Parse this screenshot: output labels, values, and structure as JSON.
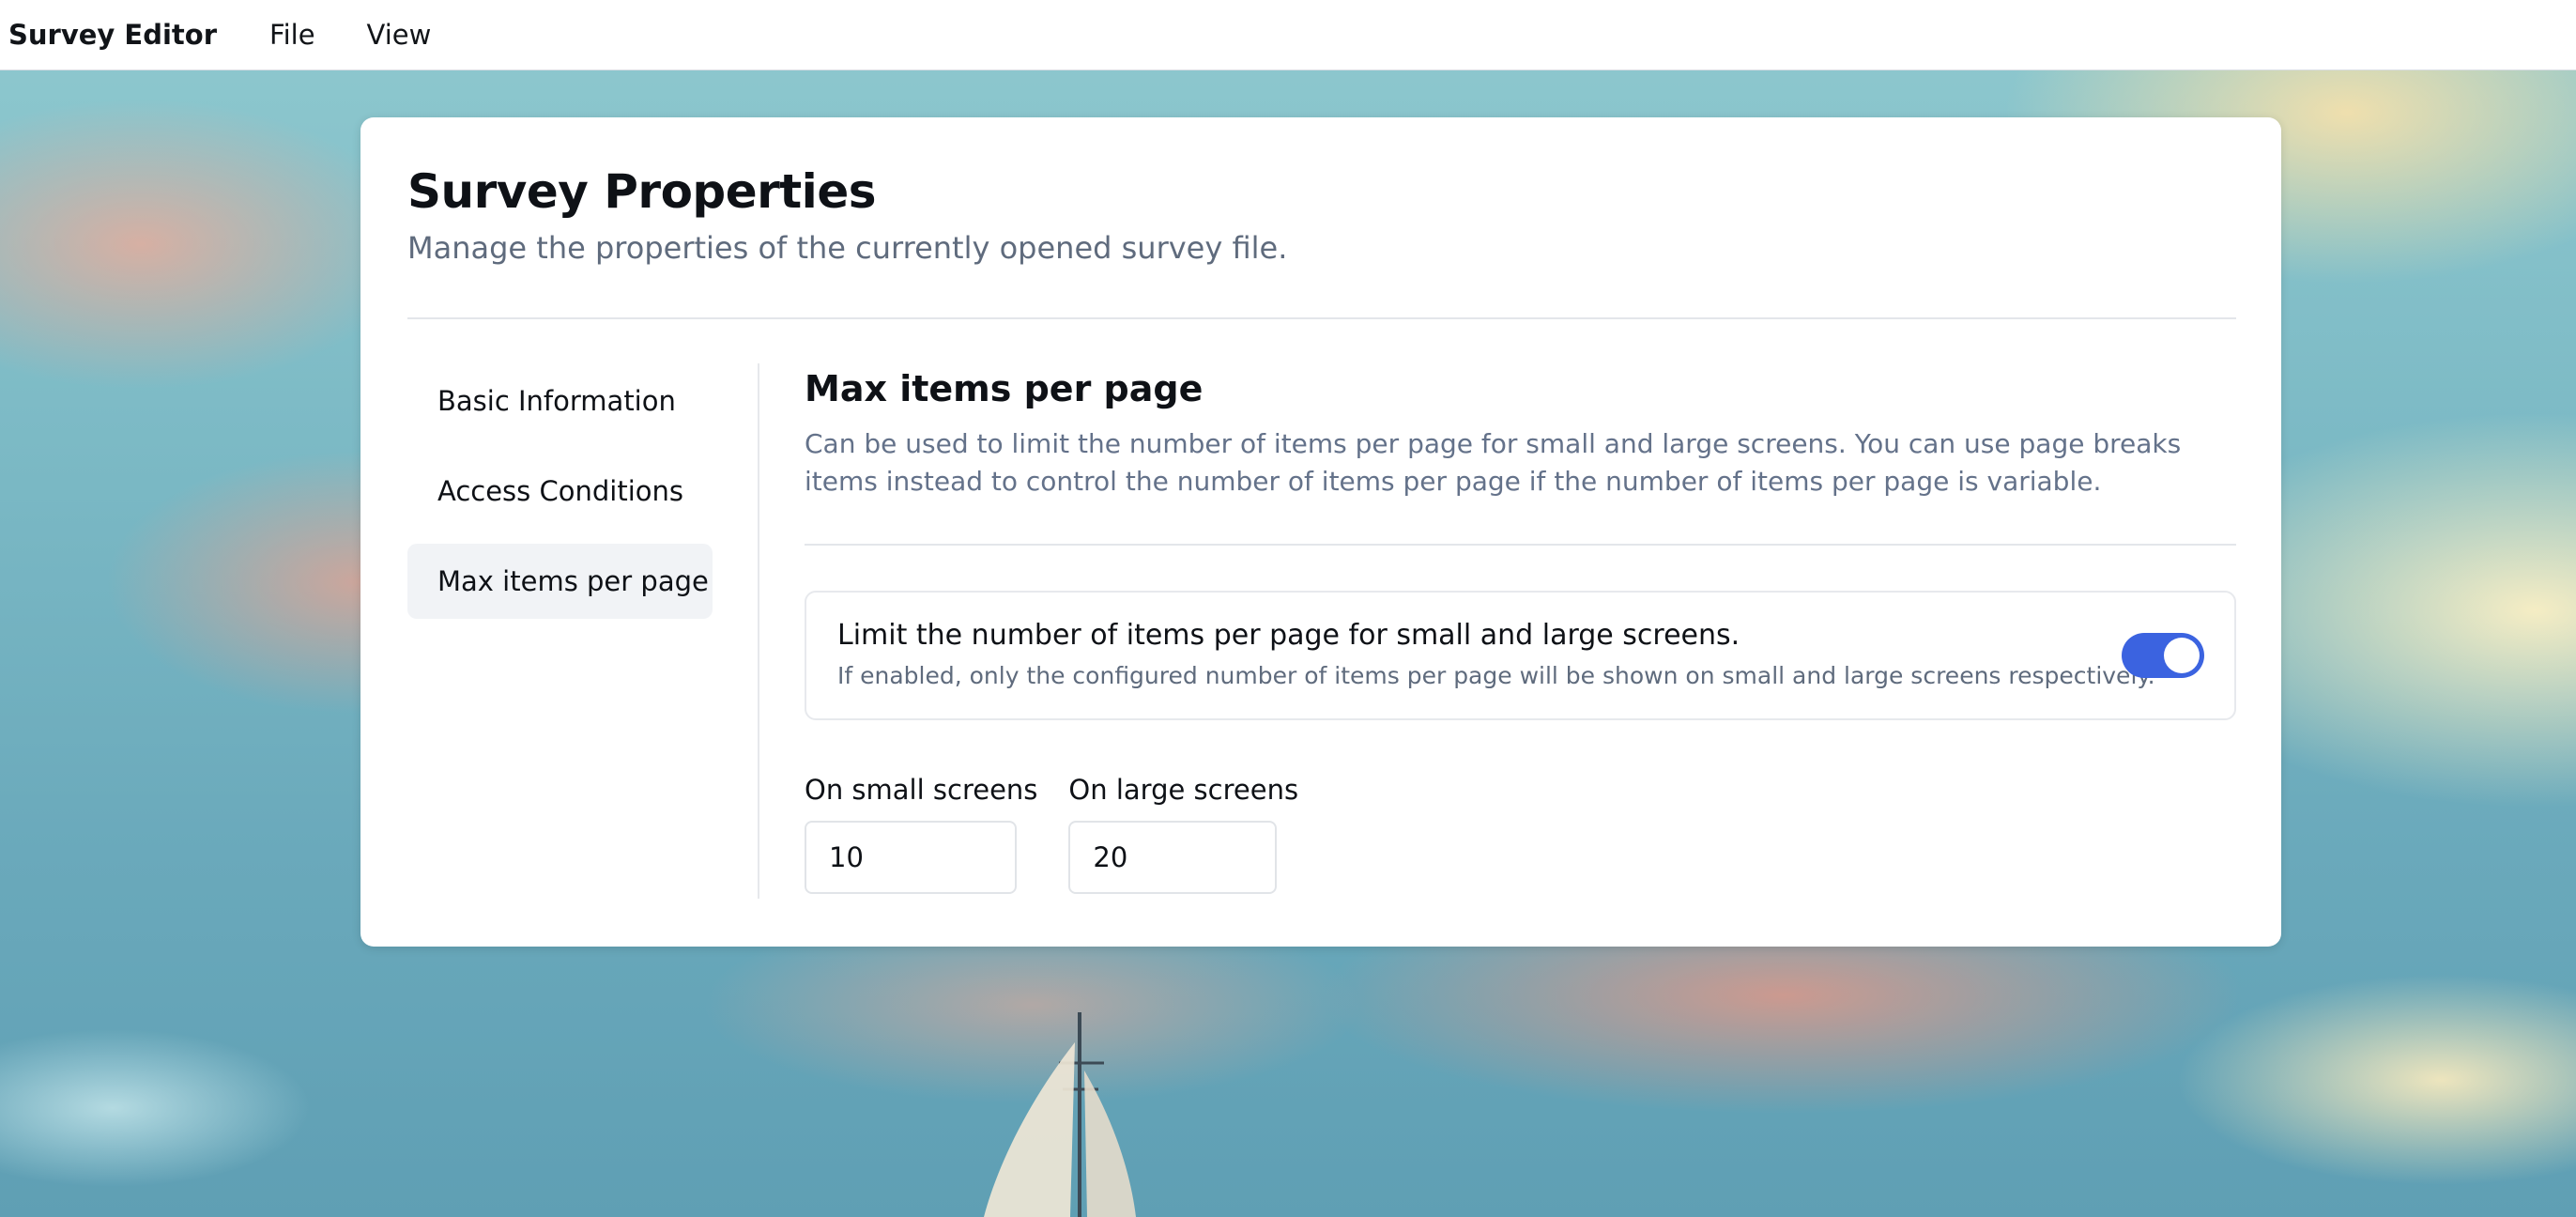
{
  "menubar": {
    "app_title": "Survey Editor",
    "file_label": "File",
    "view_label": "View"
  },
  "card": {
    "title": "Survey Properties",
    "subtitle": "Manage the properties of the currently opened survey file."
  },
  "sidenav": {
    "items": [
      {
        "label": "Basic Information",
        "active": false
      },
      {
        "label": "Access Conditions",
        "active": false
      },
      {
        "label": "Max items per page",
        "active": true
      }
    ]
  },
  "section": {
    "title": "Max items per page",
    "description": "Can be used to limit the number of items per page for small and large screens. You can use page breaks items instead to control the number of items per page if the number of items per page is variable.",
    "toggle": {
      "label": "Limit the number of items per page for small and large screens.",
      "hint": "If enabled, only the configured number of items per page will be shown on small and large screens respectively.",
      "enabled": true
    },
    "fields": {
      "small_label": "On small screens",
      "small_value": "10",
      "large_label": "On large screens",
      "large_value": "20"
    }
  },
  "colors": {
    "accent": "#3b63e0",
    "muted_text": "#64728a",
    "active_nav_bg": "#f1f3f6"
  }
}
